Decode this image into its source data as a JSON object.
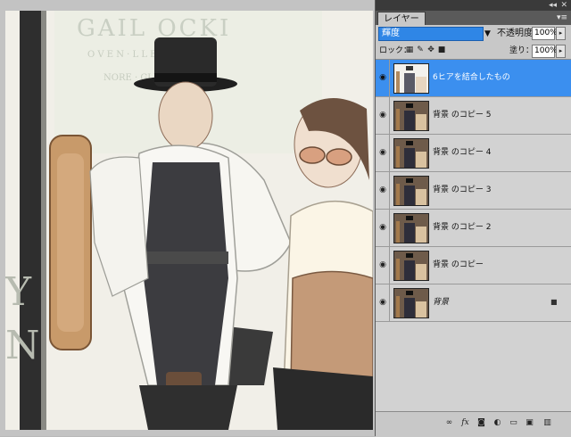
{
  "panel": {
    "top_bar": {
      "collapse_glyph": "◂◂",
      "close_glyph": "✕"
    },
    "tab_label": "レイヤー",
    "menu_glyph": "▾≡",
    "blend_mode": "輝度",
    "opacity_label": "不透明度：",
    "opacity_value": "100%",
    "lock_label": "ロック：",
    "fill_label": "塗り：",
    "fill_value": "100%",
    "layers": [
      {
        "name": "6ヒアを結合したもの",
        "selected": true
      },
      {
        "name": "背景 のコピー 5",
        "selected": false
      },
      {
        "name": "背景 のコピー 4",
        "selected": false
      },
      {
        "name": "背景 のコピー 3",
        "selected": false
      },
      {
        "name": "背景 のコピー 2",
        "selected": false
      },
      {
        "name": "背景 のコピー",
        "selected": false
      },
      {
        "name": "背景",
        "selected": false,
        "locked": true
      }
    ],
    "footer_icons": [
      "link-icon",
      "fx-icon",
      "mask-icon",
      "adjustment-icon",
      "folder-icon",
      "new-layer-icon",
      "trash-icon"
    ]
  },
  "canvas_sign": {
    "line1": "GAIL  OCKI",
    "line2": "O V E N  ·  L L E R",
    "line3": "NORE  ·  GLLEN"
  },
  "colors": {
    "selection": "#3b8fef",
    "panel_bg": "#c8c8c8",
    "list_bg": "#d2d2d2"
  }
}
